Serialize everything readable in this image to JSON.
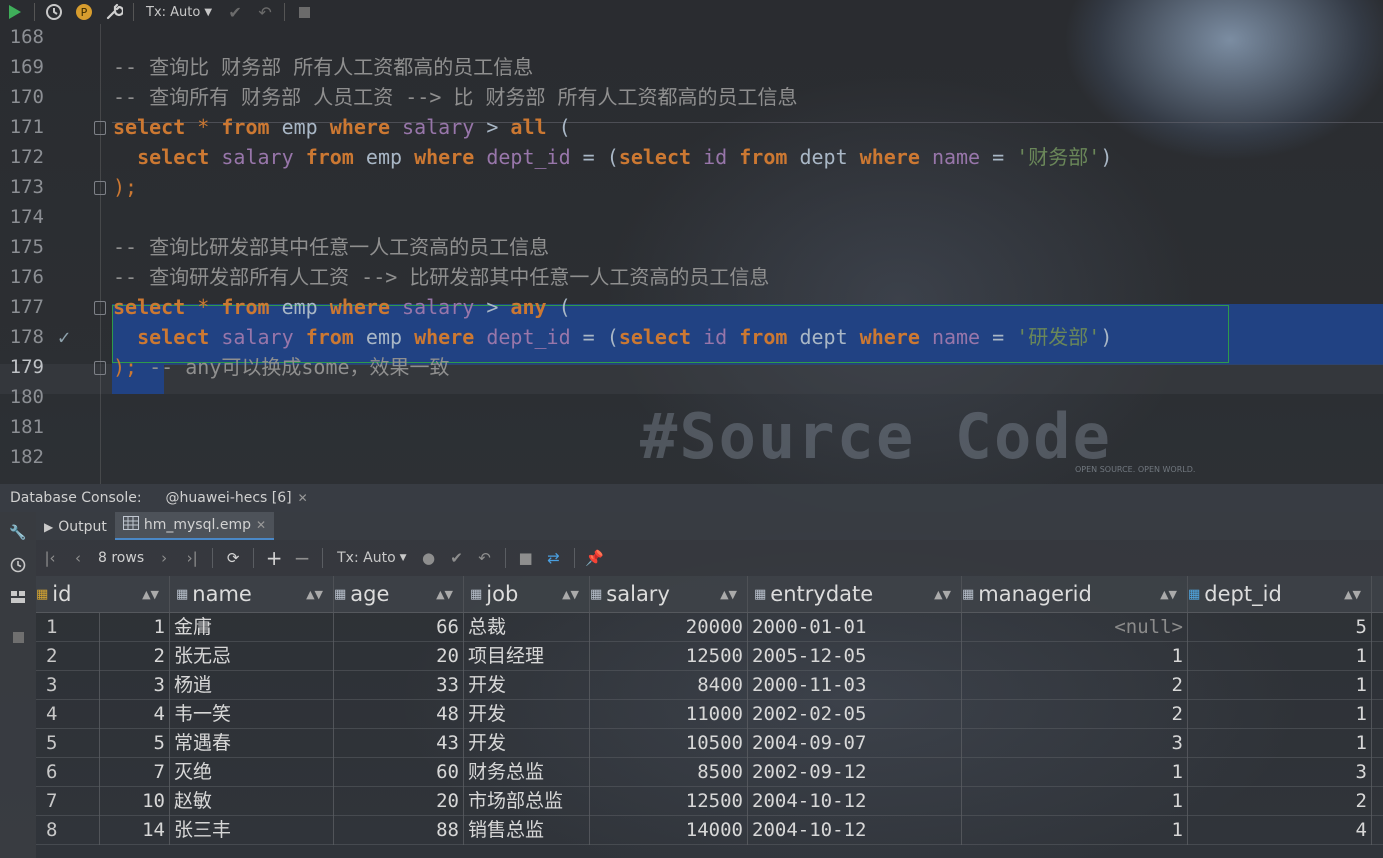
{
  "toolbar": {
    "tx_mode": "Tx: Auto"
  },
  "editor": {
    "lines": [
      {
        "num": "168"
      },
      {
        "num": "169",
        "comment": "-- 查询比 财务部 所有人工资都高的员工信息"
      },
      {
        "num": "170",
        "comment": "-- 查询所有 财务部 人员工资 --> 比 财务部 所有人工资都高的员工信息"
      },
      {
        "num": "171"
      },
      {
        "num": "172",
        "dept_value": "'财务部'"
      },
      {
        "num": "173"
      },
      {
        "num": "174"
      },
      {
        "num": "175",
        "comment": "-- 查询比研发部其中任意一人工资高的员工信息"
      },
      {
        "num": "176",
        "comment": "-- 查询研发部所有人工资 --> 比研发部其中任意一人工资高的员工信息"
      },
      {
        "num": "177"
      },
      {
        "num": "178",
        "dept_value": "'研发部'"
      },
      {
        "num": "179",
        "comment": "-- any可以换成some，效果一致"
      },
      {
        "num": "180"
      },
      {
        "num": "181"
      },
      {
        "num": "182"
      }
    ],
    "watermark": "#Source Code",
    "watermark_sub": "OPEN SOURCE. OPEN WORLD."
  },
  "console": {
    "title": "Database Console:",
    "session": "@huawei-hecs [6]"
  },
  "tabs": [
    {
      "label": "Output"
    },
    {
      "label": "hm_mysql.emp"
    }
  ],
  "results": {
    "row_count": "8 rows",
    "tx_mode": "Tx: Auto",
    "columns": [
      "id",
      "name",
      "age",
      "job",
      "salary",
      "entrydate",
      "managerid",
      "dept_id"
    ],
    "rows": [
      [
        "1",
        "1",
        "金庸",
        "66",
        "总裁",
        "20000",
        "2000-01-01",
        "<null>",
        "5"
      ],
      [
        "2",
        "2",
        "张无忌",
        "20",
        "项目经理",
        "12500",
        "2005-12-05",
        "1",
        "1"
      ],
      [
        "3",
        "3",
        "杨逍",
        "33",
        "开发",
        "8400",
        "2000-11-03",
        "2",
        "1"
      ],
      [
        "4",
        "4",
        "韦一笑",
        "48",
        "开发",
        "11000",
        "2002-02-05",
        "2",
        "1"
      ],
      [
        "5",
        "5",
        "常遇春",
        "43",
        "开发",
        "10500",
        "2004-09-07",
        "3",
        "1"
      ],
      [
        "6",
        "7",
        "灭绝",
        "60",
        "财务总监",
        "8500",
        "2002-09-12",
        "1",
        "3"
      ],
      [
        "7",
        "10",
        "赵敏",
        "20",
        "市场部总监",
        "12500",
        "2004-10-12",
        "1",
        "2"
      ],
      [
        "8",
        "14",
        "张三丰",
        "88",
        "销售总监",
        "14000",
        "2004-10-12",
        "1",
        "4"
      ]
    ]
  },
  "colors": {
    "keyword": "#cc7832",
    "field": "#9876aa",
    "string": "#6a8759",
    "comment": "#8f8f8f",
    "selection": "#214283"
  }
}
